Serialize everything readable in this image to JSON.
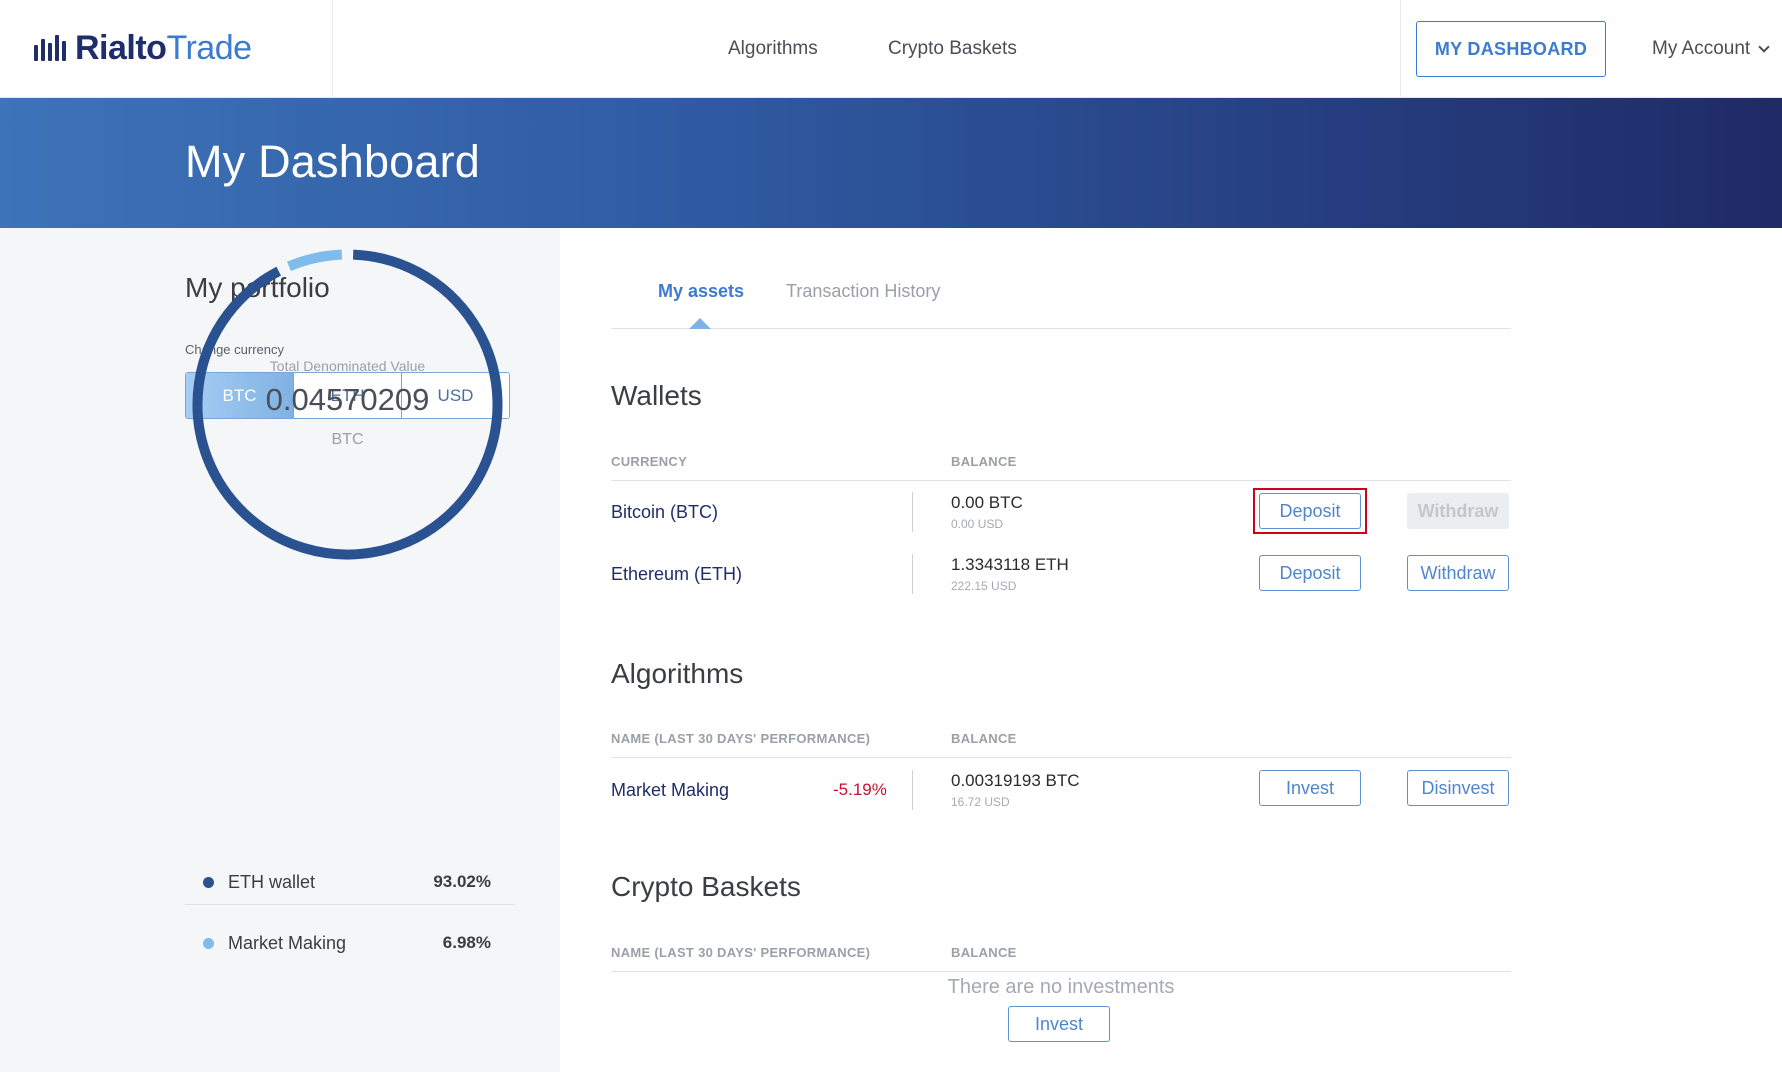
{
  "header": {
    "brand_left": "Rialto",
    "brand_right": "Trade",
    "nav": [
      {
        "label": "Algorithms"
      },
      {
        "label": "Crypto Baskets"
      }
    ],
    "dashboard_button": "MY DASHBOARD",
    "account_label": "My Account"
  },
  "hero": {
    "title": "My Dashboard"
  },
  "portfolio": {
    "title": "My portfolio",
    "change_currency_label": "Change currency",
    "currencies": [
      "BTC",
      "ETH",
      "USD"
    ],
    "selected_currency": "BTC",
    "total_label": "Total Denominated Value",
    "total_value": "0.04570209",
    "total_unit": "BTC",
    "donut": [
      {
        "name": "ETH wallet",
        "pct": "93.02%",
        "fraction": 0.9302,
        "color": "#2a5291"
      },
      {
        "name": "Market Making",
        "pct": "6.98%",
        "fraction": 0.0698,
        "color": "#7fbbeb"
      }
    ]
  },
  "tabs": {
    "assets": "My assets",
    "history": "Transaction History",
    "active": "assets"
  },
  "wallets": {
    "title": "Wallets",
    "col_currency": "CURRENCY",
    "col_balance": "BALANCE",
    "rows": [
      {
        "name": "Bitcoin (BTC)",
        "balance": "0.00 BTC",
        "usd": "0.00 USD",
        "deposit": "Deposit",
        "withdraw": "Withdraw",
        "withdraw_disabled": true
      },
      {
        "name": "Ethereum (ETH)",
        "balance": "1.3343118 ETH",
        "usd": "222.15 USD",
        "deposit": "Deposit",
        "withdraw": "Withdraw",
        "withdraw_disabled": false
      }
    ]
  },
  "algorithms": {
    "title": "Algorithms",
    "col_name": "NAME (LAST 30 DAYS' PERFORMANCE)",
    "col_balance": "BALANCE",
    "rows": [
      {
        "name": "Market Making",
        "performance": "-5.19%",
        "balance": "0.00319193 BTC",
        "usd": "16.72 USD",
        "invest": "Invest",
        "disinvest": "Disinvest"
      }
    ]
  },
  "baskets": {
    "title": "Crypto Baskets",
    "col_name": "NAME (LAST 30 DAYS' PERFORMANCE)",
    "col_balance": "BALANCE",
    "empty_text": "There are no investments",
    "invest": "Invest"
  },
  "colors": {
    "accent": "#3d7bd1",
    "brand_navy": "#1f2d6b",
    "negative": "#c8102e",
    "highlight": "#d0021b"
  }
}
